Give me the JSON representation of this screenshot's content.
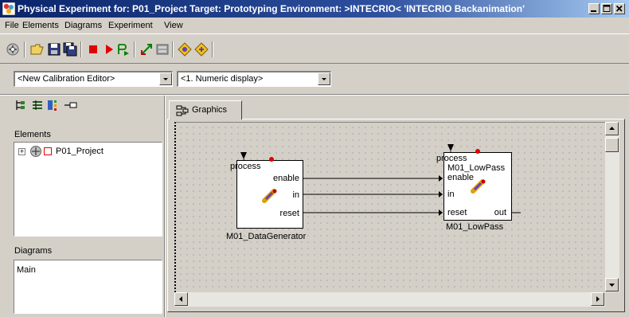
{
  "window": {
    "title": "Physical Experiment for: P01_Project  Target: Prototyping  Environment: >INTECRIO<   'INTECRIO Backanimation'"
  },
  "menu": [
    "File",
    "Elements",
    "Diagrams",
    "Experiment",
    "View"
  ],
  "toolbar": {
    "icons": [
      "connect-icon",
      "open-icon",
      "save-icon",
      "save-all-icon",
      "stop-icon",
      "run-icon",
      "step-run-icon",
      "arrange-icon",
      "calibrate-icon",
      "tool1-icon",
      "tool2-icon"
    ]
  },
  "calibration_editor": {
    "value": "<New Calibration Editor>"
  },
  "display_type": {
    "value": "<1. Numeric display>"
  },
  "elements_panel": {
    "label": "Elements",
    "tree": [
      {
        "expander": "+",
        "label": "P01_Project"
      }
    ]
  },
  "diagrams_panel": {
    "label": "Diagrams",
    "items": [
      "Main"
    ]
  },
  "tab": {
    "label": "Graphics"
  },
  "blocks": {
    "generator": {
      "name": "M01_DataGenerator",
      "process_label": "process",
      "ports_out": [
        "enable",
        "in",
        "reset"
      ]
    },
    "lowpass": {
      "name": "M01_LowPass",
      "inner_name": "M01_LowPass",
      "process_label": "process",
      "ports_in": [
        "enable",
        "in",
        "reset"
      ],
      "port_out": "out"
    }
  },
  "colors": {
    "titlebar_start": "#0a246a",
    "titlebar_end": "#a6caf0",
    "port_dot": "#e00000",
    "stop_button": "#e00000"
  }
}
